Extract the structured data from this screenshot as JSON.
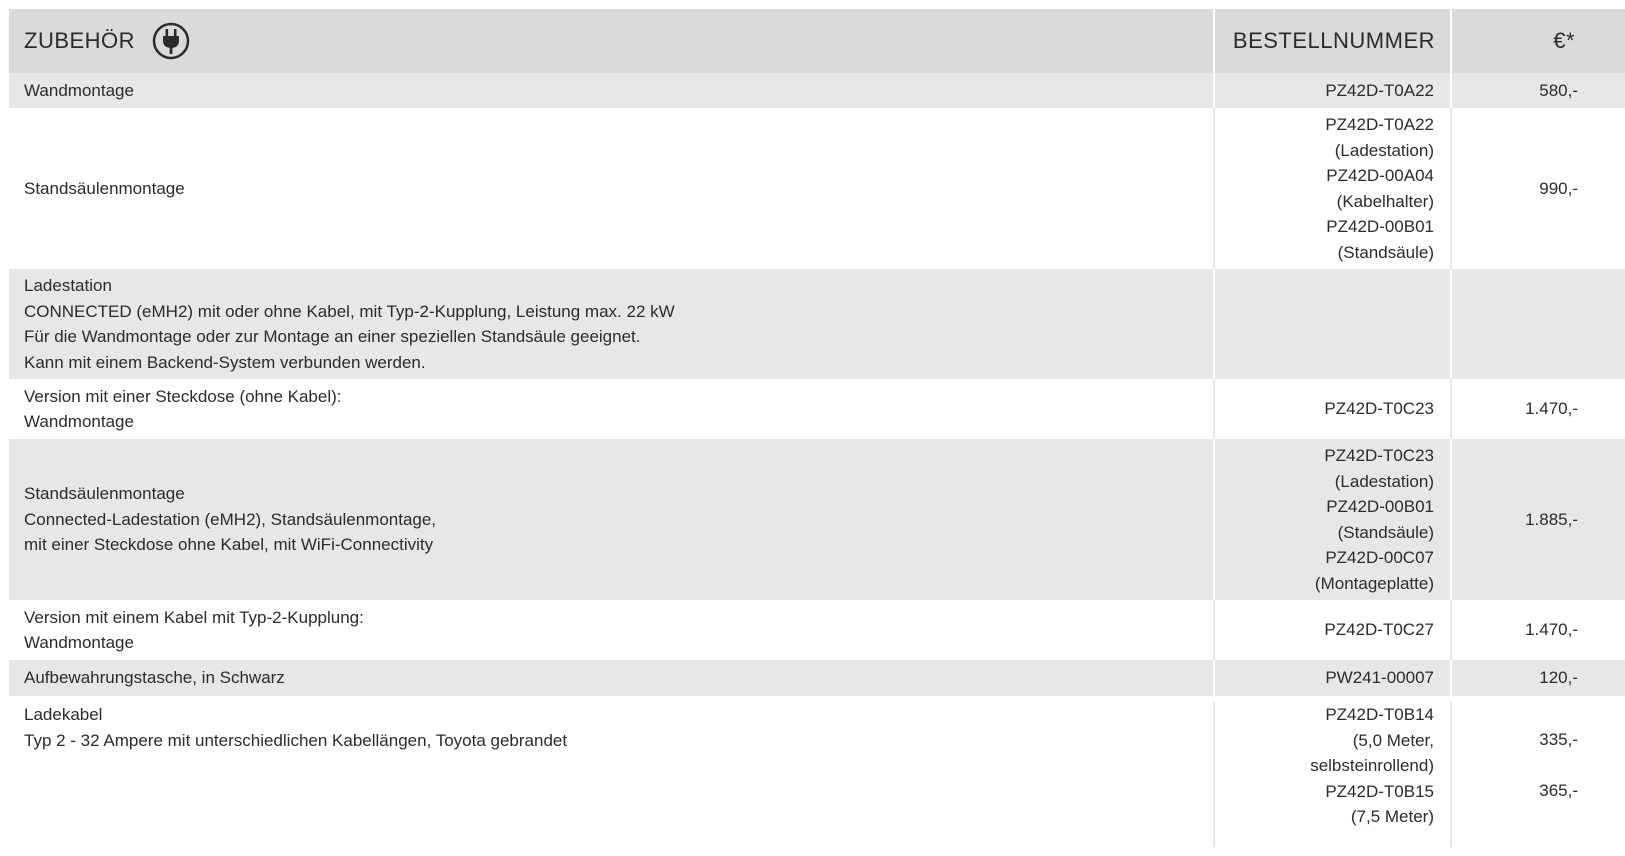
{
  "header": {
    "title": "ZUBEHÖR",
    "icon": "plug-icon",
    "order_label": "BESTELLNUMMER",
    "price_label": "€*"
  },
  "rows": [
    {
      "desc": [
        "Wandmontage"
      ],
      "order": [
        "PZ42D-T0A22"
      ],
      "price": [
        "580,-"
      ]
    },
    {
      "desc": [
        "Standsäulenmontage"
      ],
      "order": [
        "PZ42D-T0A22",
        "(Ladestation)",
        "PZ42D-00A04",
        "(Kabelhalter)",
        "PZ42D-00B01",
        "(Standsäule)"
      ],
      "price": [
        "990,-"
      ]
    },
    {
      "desc": [
        "Ladestation",
        "CONNECTED (eMH2) mit oder ohne Kabel, mit Typ-2-Kupplung, Leistung max. 22 kW",
        "Für die Wandmontage oder zur Montage an einer speziellen Standsäule geeignet.",
        "Kann mit einem Backend-System verbunden werden."
      ],
      "order": [],
      "price": []
    },
    {
      "desc": [
        "Version mit einer Steckdose (ohne Kabel):",
        "Wandmontage"
      ],
      "order": [
        "PZ42D-T0C23"
      ],
      "price": [
        "1.470,-"
      ]
    },
    {
      "desc": [
        "Standsäulenmontage",
        "Connected-Ladestation (eMH2), Standsäulenmontage,",
        "mit einer Steckdose ohne Kabel, mit WiFi-Connectivity"
      ],
      "order": [
        "PZ42D-T0C23",
        "(Ladestation)",
        "PZ42D-00B01",
        "(Standsäule)",
        "PZ42D-00C07",
        "(Montageplatte)"
      ],
      "price": [
        "1.885,-"
      ]
    },
    {
      "desc": [
        "Version mit einem Kabel mit Typ-2-Kupplung:",
        "Wandmontage"
      ],
      "order": [
        "PZ42D-T0C27"
      ],
      "price": [
        "1.470,-"
      ]
    },
    {
      "desc": [
        "Aufbewahrungstasche, in Schwarz"
      ],
      "order": [
        "PW241-00007"
      ],
      "price": [
        "120,-"
      ]
    },
    {
      "desc": [
        "Ladekabel",
        "Typ 2 - 32 Ampere mit unterschiedlichen Kabellängen, Toyota gebrandet"
      ],
      "order": [
        "PZ42D-T0B14",
        "(5,0 Meter,",
        "selbsteinrollend)",
        "PZ42D-T0B15",
        "(7,5 Meter)"
      ],
      "price": [
        "335,-",
        "365,-"
      ]
    }
  ]
}
